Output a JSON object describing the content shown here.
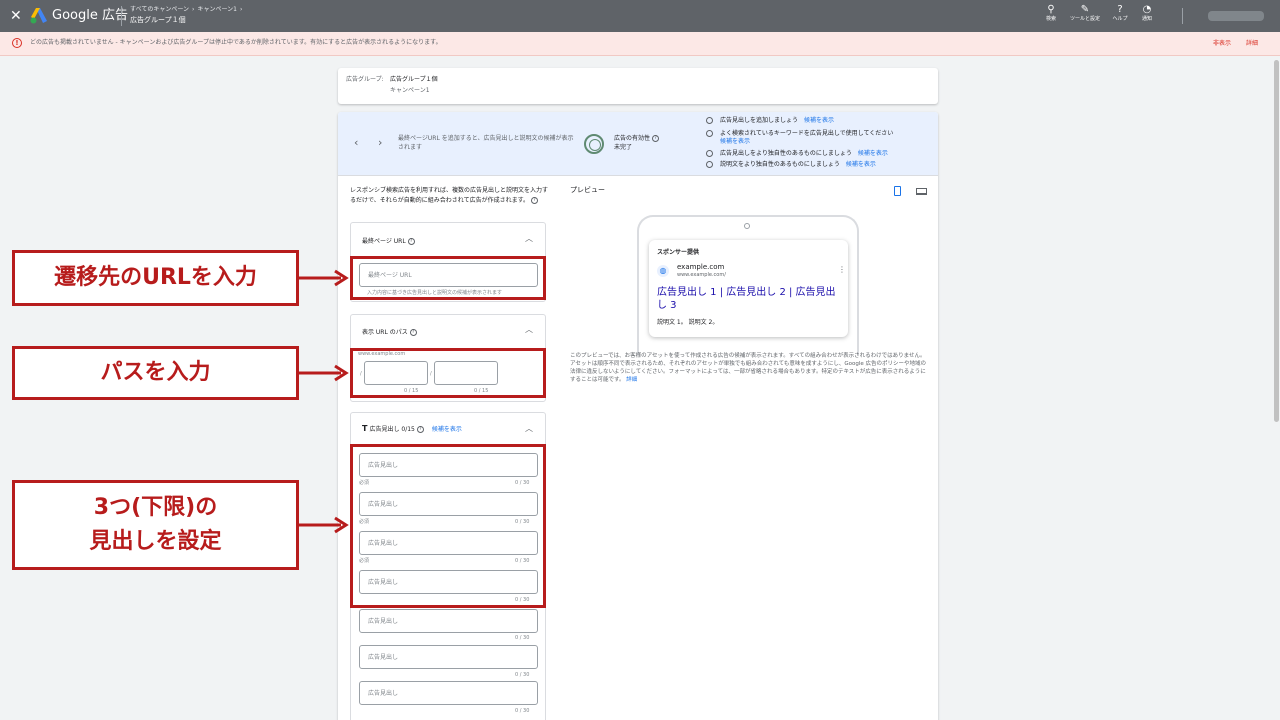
{
  "topbar": {
    "close_glyph": "✕",
    "brand": "Google 広告",
    "crumbs": [
      "すべてのキャンペーン",
      "キャンペーン1"
    ],
    "crumb_sep": "›",
    "title": "広告グループ１個",
    "tools": [
      {
        "icon": "search-icon",
        "glyph": "⚲",
        "label": "検索"
      },
      {
        "icon": "wrench-icon",
        "glyph": "✎",
        "label": "ツールと設定"
      },
      {
        "icon": "help-icon",
        "glyph": "?",
        "label": "ヘルプ"
      },
      {
        "icon": "bell-icon",
        "glyph": "◔",
        "label": "通知"
      }
    ]
  },
  "alert": {
    "icon": "alert-icon",
    "glyph": "!",
    "text": "どの広告も掲載されていません - キャンペーンおよび広告グループは停止中であるか削除されています。有効にすると広告が表示されるようになります。",
    "hide": "非表示",
    "details": "詳細"
  },
  "adgroup": {
    "key": "広告グループ:",
    "name": "広告グループ１個",
    "campaign": "キャンペーン1"
  },
  "strength": {
    "message": "最終ページURL を追加すると、広告見出しと説明文の候補が表示されます",
    "label": "広告の有効性",
    "help": "?",
    "value": "未完了",
    "suggestions": [
      {
        "text": "広告見出しを追加しましょう",
        "link": "候補を表示"
      },
      {
        "text": "よく検索されているキーワードを広告見出しで使用してください",
        "link": "候補を表示"
      },
      {
        "text": "広告見出しをより独自性のあるものにしましょう",
        "link": "候補を表示"
      },
      {
        "text": "説明文をより独自性のあるものにしましょう",
        "link": "候補を表示"
      }
    ]
  },
  "intro": "レスポンシブ検索広告を利用すれば、複数の広告見出しと説明文を入力するだけで、それらが自動的に組み合わされて広告が作成されます。",
  "final_url": {
    "title": "最終ページ URL",
    "placeholder": "最終ページ URL",
    "hint": "入力内容に基づき広告見出しと説明文の候補が表示されます"
  },
  "display_path": {
    "title": "表示 URL のパス",
    "base": "www.example.com",
    "slash": "/",
    "counter": "0 / 15"
  },
  "headlines": {
    "title": "広告見出し 0/15",
    "suggest": "候補を表示",
    "placeholder": "広告見出し",
    "required": "必須",
    "counter": "0 / 30"
  },
  "caret": "︿",
  "preview": {
    "title": "プレビュー",
    "sponsored": "スポンサー提供",
    "domain": "example.com",
    "url": "www.example.com/",
    "headline": "広告見出し 1 | 広告見出し 2 | 広告見出し 3",
    "description": "説明文 1。 説明文 2。",
    "note": "このプレビューでは、お客様のアセットを使って作成される広告の候補が表示されます。すべての組み合わせが表示されるわけではありません。アセットは順序不同で表示されるため、それぞれのアセットが単独でも組み合わされても意味を成すようにし、Google 広告のポリシーや地域の法律に違反しないようにしてください。フォーマットによっては、一部が省略される場合もあります。特定のテキストが広告に表示されるようにすることは可能です。",
    "note_link": "詳細"
  },
  "annotations": {
    "url": "遷移先のURLを入力",
    "path": "パスを入力",
    "headline_line1": "3つ(下限)の",
    "headline_line2": "見出しを設定",
    "color": "#b71c1c"
  }
}
